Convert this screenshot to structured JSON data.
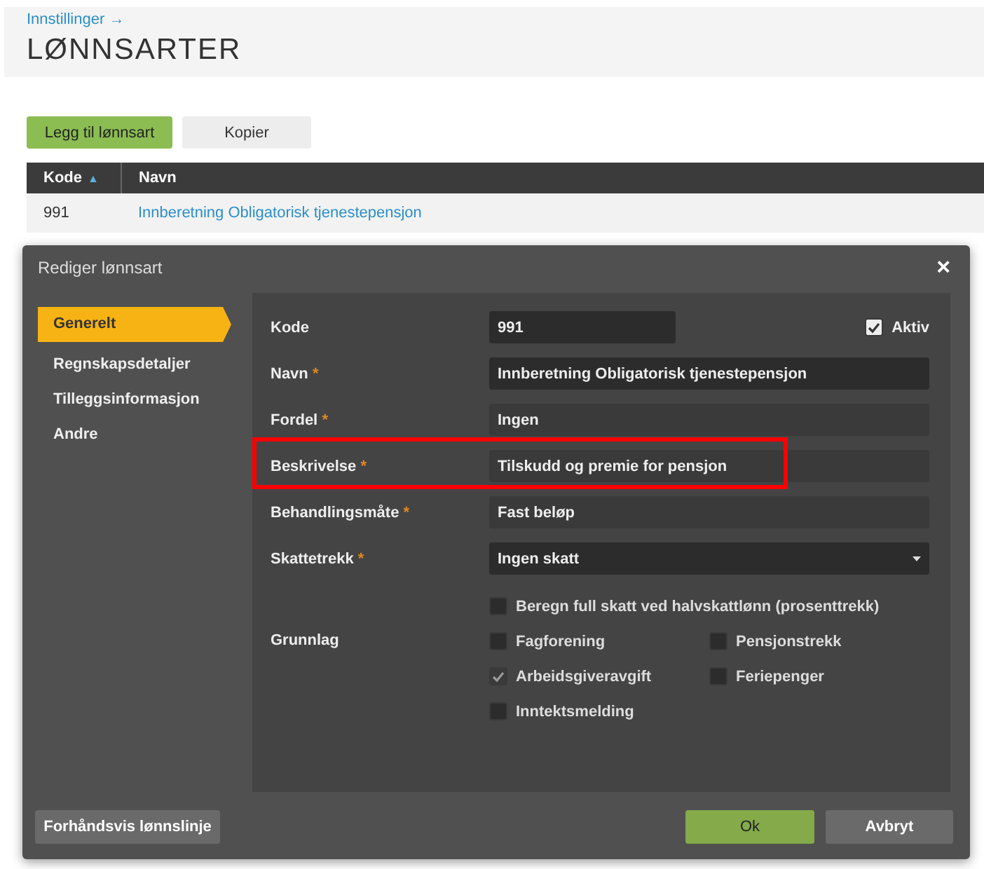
{
  "breadcrumb": "Innstillinger →",
  "page_title": "LØNNSARTER",
  "toolbar": [
    {
      "label": "Legg til lønnsart",
      "kind": "primary"
    },
    {
      "label": "Kopier",
      "kind": "secondary"
    }
  ],
  "table": {
    "columns": [
      {
        "label": "Kode",
        "sort_icon": "▲"
      },
      {
        "label": "Navn"
      }
    ],
    "rows": [
      {
        "cells": [
          "991",
          "Innberetning Obligatorisk tjenestepensjon"
        ]
      }
    ]
  },
  "dialog": {
    "title": "Rediger lønnsart",
    "close": "×",
    "nav": [
      {
        "label": "Generelt",
        "selected": true
      },
      {
        "label": "Regnskapsdetaljer",
        "selected": false
      },
      {
        "label": "Tilleggsinformasjon",
        "selected": false
      },
      {
        "label": "Andre",
        "selected": false
      }
    ],
    "fields": [
      {
        "label": "Kode",
        "kind": "short",
        "value": "991",
        "checkbox": {
          "label": "Aktiv",
          "checked": true
        }
      },
      {
        "label": "Navn",
        "kind": "text",
        "value": "Innberetning Obligatorisk tjenestepensjon",
        "required_mark": "*"
      },
      {
        "label": "Fordel",
        "kind": "text",
        "value": "Ingen",
        "required_mark": "*"
      },
      {
        "label": "Beskrivelse",
        "kind": "text",
        "value": "Tilskudd og premie for pensjon",
        "required_mark": "*",
        "highlighted": true
      },
      {
        "label": "Behandlingsmåte",
        "kind": "text",
        "value": "Fast beløp",
        "required_mark": "*"
      },
      {
        "label": "Skattetrekk",
        "kind": "select",
        "value": "Ingen skatt",
        "required_mark": "*"
      }
    ],
    "tax_option": {
      "label": "Beregn full skatt ved halvskattlønn (prosenttrekk)",
      "checked": false
    },
    "basis": {
      "label": "Grunnlag",
      "options": [
        {
          "label": "Fagforening",
          "checked": false
        },
        {
          "label": "Pensjonstrekk",
          "checked": false
        },
        {
          "label": "Arbeidsgiveravgift",
          "checked": true
        },
        {
          "label": "Feriepenger",
          "checked": false
        },
        {
          "label": "Inntektsmelding",
          "checked": false
        }
      ]
    },
    "buttons": [
      {
        "label": "Forhåndsvis lønnslinje",
        "kind": "secondary"
      },
      {
        "label": "Ok",
        "kind": "primary"
      },
      {
        "label": "Avbryt",
        "kind": "secondary"
      }
    ]
  }
}
